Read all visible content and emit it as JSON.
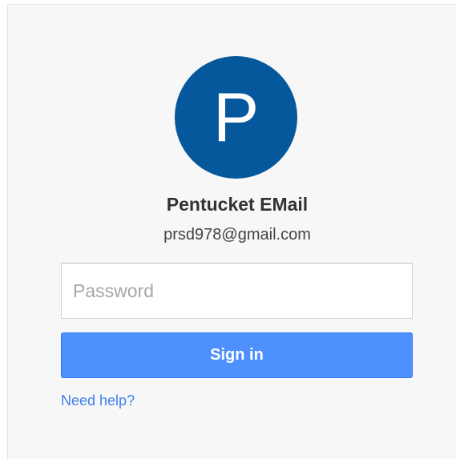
{
  "account": {
    "avatar_letter": "P",
    "name": "Pentucket EMail",
    "email": "prsd978@gmail.com"
  },
  "form": {
    "password_placeholder": "Password",
    "password_value": "",
    "signin_label": "Sign in",
    "help_link": "Need help?"
  },
  "colors": {
    "avatar_bg": "#06589c",
    "button_bg": "#4d90fe",
    "link": "#427fed",
    "card_bg": "#f7f7f7"
  }
}
